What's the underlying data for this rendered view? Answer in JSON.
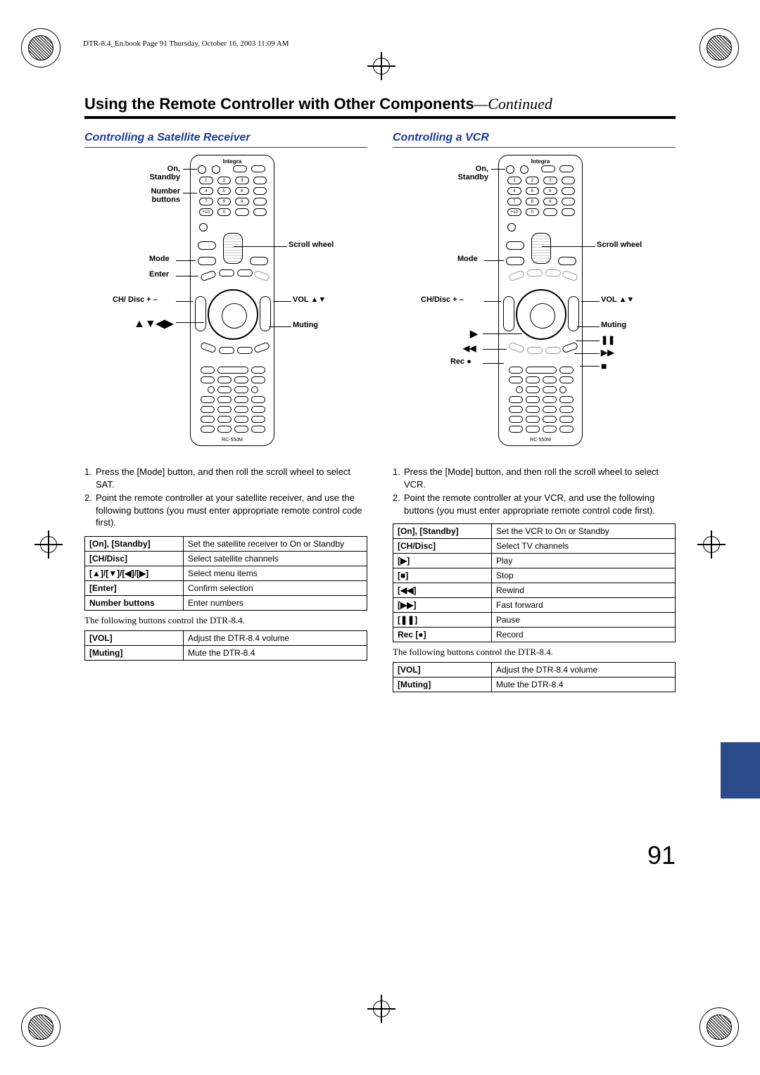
{
  "header_line": "DTR-8.4_En.book  Page 91  Thursday, October 16, 2003  11:09 AM",
  "page_title_main": "Using the Remote Controller with Other Components",
  "page_title_cont": "—Continued",
  "page_number": "91",
  "remote_brand": "Integra",
  "remote_model": "RC-550M",
  "left": {
    "subhead": "Controlling a Satellite Receiver",
    "labels": {
      "on_standby": "On,\nStandby",
      "number_buttons": "Number\nbuttons",
      "mode": "Mode",
      "enter": "Enter",
      "ch_disc": "CH/ Disc + –",
      "arrows": "▲▼◀▶",
      "scroll_wheel": "Scroll wheel",
      "vol": "VOL ▲▼",
      "muting": "Muting"
    },
    "steps": [
      "Press the [Mode] button, and then roll the scroll wheel to select  SAT.",
      "Point the remote controller at your satellite receiver, and use the following buttons (you must enter appropriate remote control code ﬁrst)."
    ],
    "table": [
      [
        "[On], [Standby]",
        "Set the satellite receiver to On or Standby"
      ],
      [
        "[CH/Disc]",
        "Select satellite channels"
      ],
      [
        "[▲]/[▼]/[◀]/[▶]",
        "Select menu items"
      ],
      [
        "[Enter]",
        "Confirm selection"
      ],
      [
        "Number buttons",
        "Enter numbers"
      ]
    ],
    "follow": "The following buttons control the DTR-8.4.",
    "table2": [
      [
        "[VOL]",
        "Adjust the DTR-8.4 volume"
      ],
      [
        "[Muting]",
        "Mute the DTR-8.4"
      ]
    ]
  },
  "right": {
    "subhead": "Controlling a VCR",
    "labels": {
      "on_standby": "On,\nStandby",
      "mode": "Mode",
      "ch_disc": "CH/Disc + –",
      "play": "▶",
      "rew": "◀◀",
      "rec": "Rec ●",
      "scroll_wheel": "Scroll wheel",
      "vol": "VOL ▲▼",
      "muting": "Muting",
      "pause": "❚❚",
      "ff": "▶▶",
      "stop": "■"
    },
    "steps": [
      "Press the [Mode] button, and then roll the scroll wheel to select  VCR.",
      "Point the remote controller at your VCR, and use the following buttons (you must enter appropriate remote control code ﬁrst)."
    ],
    "table": [
      [
        "[On], [Standby]",
        "Set the VCR to On or Standby"
      ],
      [
        "[CH/Disc]",
        "Select TV channels"
      ],
      [
        "[▶]",
        "Play"
      ],
      [
        "[■]",
        "Stop"
      ],
      [
        "[◀◀]",
        "Rewind"
      ],
      [
        "[▶▶]",
        "Fast forward"
      ],
      [
        "[❚❚]",
        "Pause"
      ],
      [
        "Rec [●]",
        "Record"
      ]
    ],
    "follow": "The following buttons control the DTR-8.4.",
    "table2": [
      [
        "[VOL]",
        "Adjust the DTR-8.4 volume"
      ],
      [
        "[Muting]",
        "Mute the DTR-8.4"
      ]
    ]
  }
}
